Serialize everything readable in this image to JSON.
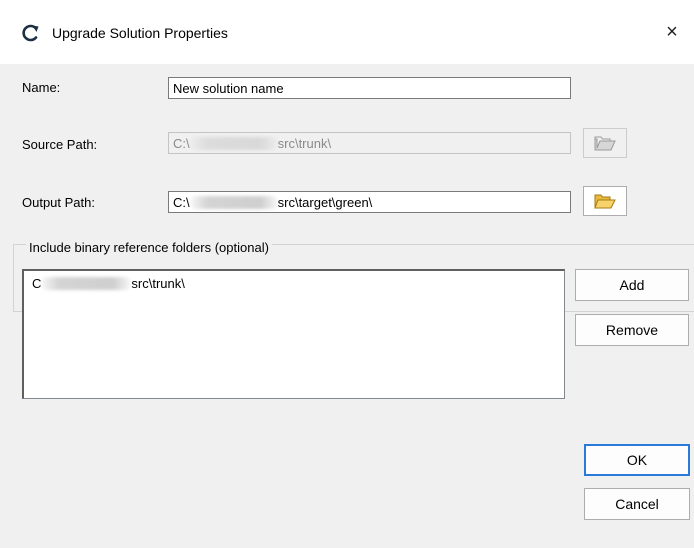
{
  "window": {
    "title": "Upgrade Solution Properties",
    "title_icon": "circular-arrow-icon",
    "close_glyph": "×"
  },
  "form": {
    "name_label": "Name:",
    "name_value": "New solution name",
    "source_label": "Source Path:",
    "source_prefix": "C:\\",
    "source_suffix": "src\\trunk\\",
    "output_label": "Output Path:",
    "output_prefix": "C:\\",
    "output_suffix": "src\\target\\green\\"
  },
  "group": {
    "legend": "Include binary reference folders (optional)",
    "items": [
      {
        "prefix": "C",
        "suffix": "src\\trunk\\"
      }
    ]
  },
  "buttons": {
    "add": "Add",
    "remove": "Remove",
    "ok": "OK",
    "cancel": "Cancel"
  },
  "colors": {
    "background": "#f0f0f0",
    "default_button_border": "#2b79d8",
    "folder_yellow": "#f7d36b"
  }
}
